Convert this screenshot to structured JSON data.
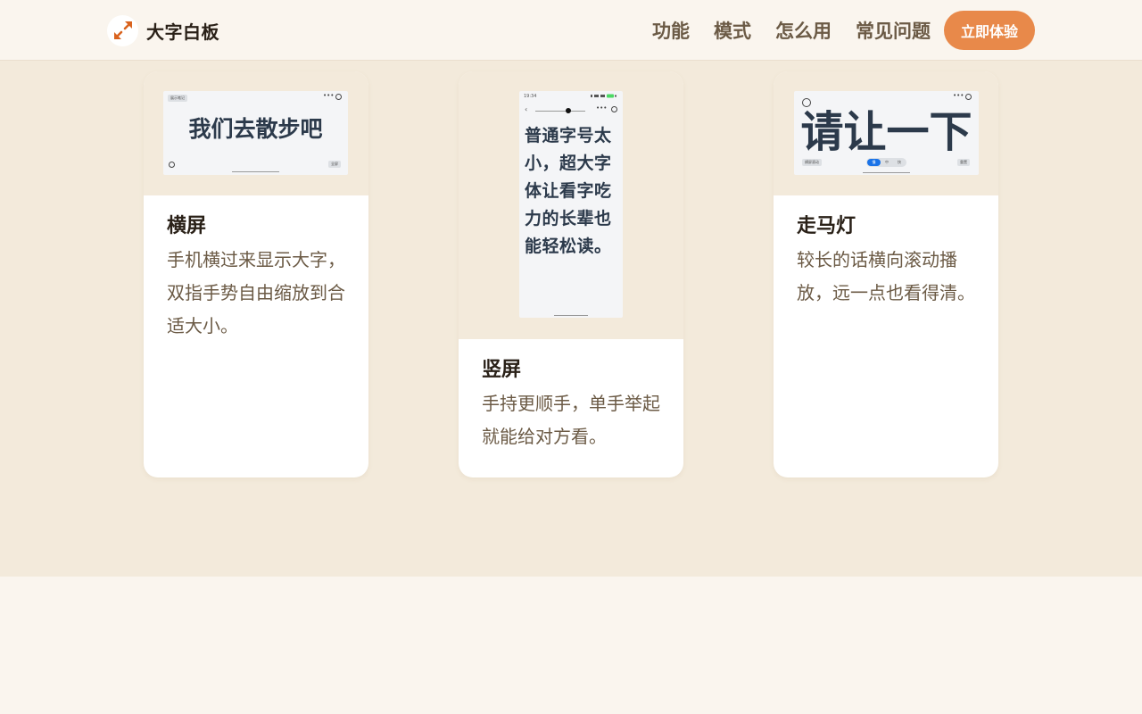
{
  "header": {
    "brand_name": "大字白板",
    "nav": [
      "功能",
      "模式",
      "怎么用",
      "常见问题"
    ],
    "cta_label": "立即体验"
  },
  "colors": {
    "accent": "#e8894a",
    "logo_arrow": "#d9631e",
    "section_bg": "#f3eadb",
    "page_bg": "#faf5ee",
    "title_text": "#2a2118",
    "muted_text": "#6b5a45",
    "screen_text": "#2c3a4b"
  },
  "cards": [
    {
      "title": "横屏",
      "description": "手机横过来显示大字，双指手势自由缩放到合适大小。",
      "screen": {
        "text": "我们去散步吧",
        "chip_top": "展示笔记",
        "chip_bottom": "全屏",
        "menu": "•••"
      }
    },
    {
      "title": "竖屏",
      "description": "手持更顺手，单手举起就能给对方看。",
      "screen": {
        "time": "19:34",
        "back": "‹",
        "menu": "•••",
        "text": "普通字号太小，超大字体让看字吃力的长辈也能轻松读。"
      }
    },
    {
      "title": "走马灯",
      "description": "较长的话横向滚动播放，远一点也看得清。",
      "screen": {
        "text": "请让一下",
        "chip_left": "横屏滚动",
        "chip_right": "重置",
        "menu": "•••",
        "segments": [
          "慢",
          "中",
          "快"
        ]
      }
    }
  ]
}
